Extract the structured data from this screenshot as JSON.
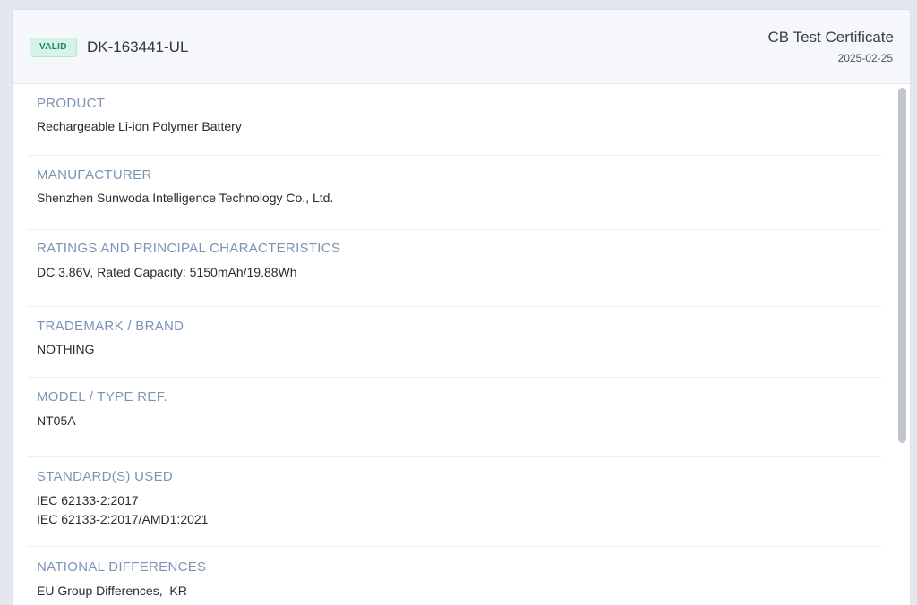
{
  "header": {
    "status_badge": "VALID",
    "certificate_number": "DK-163441-UL",
    "certificate_type": "CB Test Certificate",
    "date": "2025-02-25"
  },
  "fields": [
    {
      "label": "PRODUCT",
      "values": [
        "Rechargeable Li-ion Polymer Battery"
      ]
    },
    {
      "label": "MANUFACTURER",
      "values": [
        "Shenzhen Sunwoda Intelligence Technology Co., Ltd."
      ]
    },
    {
      "label": "RATINGS AND PRINCIPAL CHARACTERISTICS",
      "values": [
        "DC 3.86V, Rated Capacity: 5150mAh/19.88Wh"
      ]
    },
    {
      "label": "TRADEMARK / BRAND",
      "values": [
        "NOTHING"
      ]
    },
    {
      "label": "MODEL / TYPE REF.",
      "values": [
        "NT05A"
      ]
    },
    {
      "label": "STANDARD(S) USED",
      "values": [
        "IEC 62133-2:2017",
        "IEC 62133-2:2017/AMD1:2021"
      ]
    },
    {
      "label": "NATIONAL DIFFERENCES",
      "values": [
        "EU Group Differences,  KR"
      ]
    }
  ],
  "colors": {
    "badge_bg": "#d6f3ea",
    "badge_text": "#16855d",
    "label_text": "#7a94b5",
    "value_text": "#262b33"
  }
}
